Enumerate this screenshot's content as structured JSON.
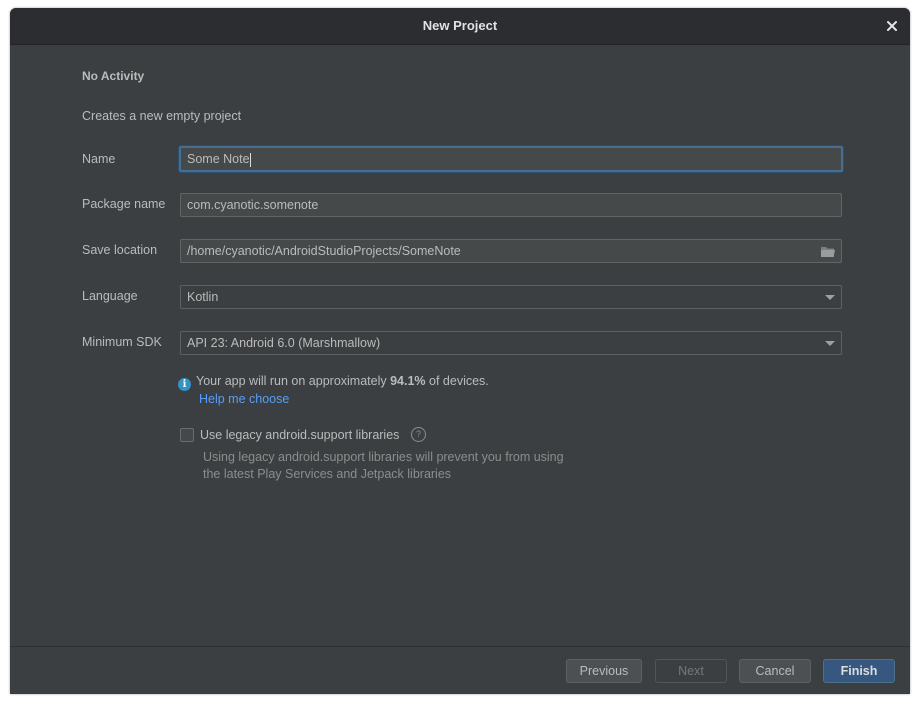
{
  "window": {
    "title": "New Project"
  },
  "section": {
    "title": "No Activity",
    "description": "Creates a new empty project"
  },
  "form": {
    "name": {
      "label": "Name",
      "value": "Some Note"
    },
    "package_name": {
      "label": "Package name",
      "value": "com.cyanotic.somenote"
    },
    "save_location": {
      "label": "Save location",
      "value": "/home/cyanotic/AndroidStudioProjects/SomeNote"
    },
    "language": {
      "label": "Language",
      "value": "Kotlin"
    },
    "minimum_sdk": {
      "label": "Minimum SDK",
      "value": "API 23: Android 6.0 (Marshmallow)"
    }
  },
  "info": {
    "prefix": "Your app will run on approximately ",
    "percent": "94.1%",
    "suffix": " of devices.",
    "help_link": "Help me choose"
  },
  "legacy": {
    "checked": false,
    "label": "Use legacy android.support libraries",
    "help_glyph": "?",
    "description_line1": "Using legacy android.support libraries will prevent you from using",
    "description_line2": "the latest Play Services and Jetpack libraries"
  },
  "buttons": {
    "previous": "Previous",
    "next": "Next",
    "cancel": "Cancel",
    "finish": "Finish"
  },
  "icons": {
    "close": "close-icon",
    "folder": "folder-icon",
    "info": "info-icon",
    "dropdown": "chevron-down-icon"
  },
  "colors": {
    "background": "#3c3f41",
    "titlebar": "#2b2d30",
    "focus_border": "#466d94",
    "link": "#589df6",
    "primary_button": "#365880"
  }
}
